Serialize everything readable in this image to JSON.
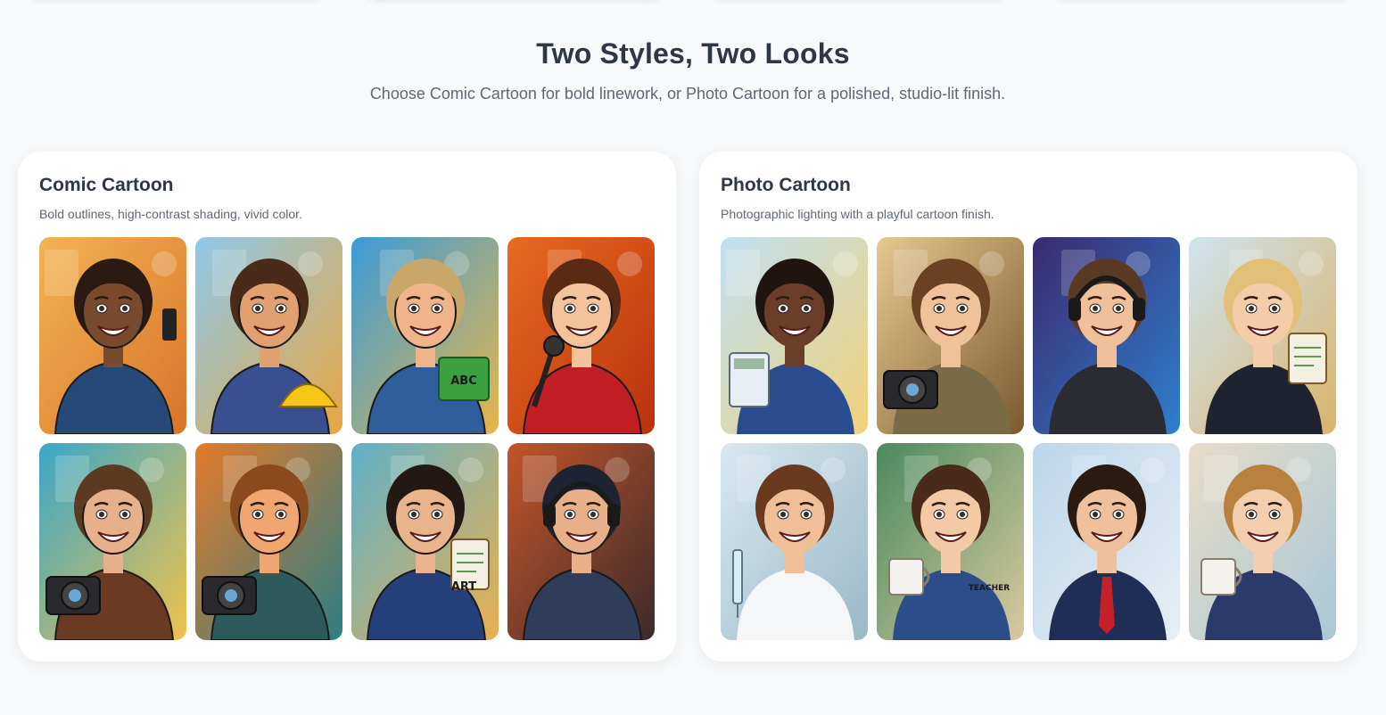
{
  "section": {
    "title": "Two Styles, Two Looks",
    "subtitle": "Choose Comic Cartoon for bold linework, or Photo Cartoon for a polished, studio-lit finish."
  },
  "panels": [
    {
      "title": "Comic Cartoon",
      "description": "Bold outlines, high-contrast shading, vivid color.",
      "images": [
        {
          "subject": "Businesswoman with phone",
          "bg": "#f2b451",
          "bg2": "#d9732a",
          "skin": "#7a4a2e",
          "hair": "#2a1a12",
          "outfit": "#254a7a",
          "prop": "phone"
        },
        {
          "subject": "Construction engineer with blueprints",
          "bg": "#8ec9ea",
          "bg2": "#e9a640",
          "skin": "#e0a070",
          "hair": "#4a2a18",
          "outfit": "#3a4f8f",
          "prop": "hardhat"
        },
        {
          "subject": "Teacher with ABC book",
          "bg": "#3a9bd8",
          "bg2": "#e8b64a",
          "skin": "#f0b48a",
          "hair": "#c9a76a",
          "outfit": "#2e5e9c",
          "prop": "book",
          "text": "ABC"
        },
        {
          "subject": "Singer with microphone",
          "bg": "#ea6a1f",
          "bg2": "#b8320e",
          "skin": "#f3c39c",
          "hair": "#5a2a14",
          "outfit": "#c21f25",
          "prop": "mic"
        },
        {
          "subject": "Traveler with camera",
          "bg": "#3aa6c9",
          "bg2": "#f1c24a",
          "skin": "#e6b08a",
          "hair": "#5c3a22",
          "outfit": "#6a3a24",
          "prop": "camera"
        },
        {
          "subject": "Photographer with camera",
          "bg": "#e47a2a",
          "bg2": "#2c7f86",
          "skin": "#f0a670",
          "hair": "#8a4a1e",
          "outfit": "#2f5a5c",
          "prop": "camera"
        },
        {
          "subject": "Art teacher with clipboard",
          "bg": "#5fb0c8",
          "bg2": "#e9b050",
          "skin": "#e9b48c",
          "hair": "#231814",
          "outfit": "#253f7a",
          "prop": "clipboard",
          "text": "ART"
        },
        {
          "subject": "Gamer with headset",
          "bg": "#c4552a",
          "bg2": "#3b2a2a",
          "skin": "#e7b088",
          "hair": "#1e2332",
          "outfit": "#2f3d5a",
          "prop": "headset"
        }
      ]
    },
    {
      "title": "Photo Cartoon",
      "description": "Photographic lighting with a playful cartoon finish.",
      "images": [
        {
          "subject": "Accountant with calculator",
          "bg": "#bfe0f2",
          "bg2": "#f2d27a",
          "skin": "#6a3e28",
          "hair": "#1f1410",
          "outfit": "#2a4d8f",
          "prop": "calculator"
        },
        {
          "subject": "Photographer with camera",
          "bg": "#e6c890",
          "bg2": "#7a5a30",
          "skin": "#f0c29a",
          "hair": "#6a4222",
          "outfit": "#7a6a48",
          "prop": "camera"
        },
        {
          "subject": "Streamer at gaming desk",
          "bg": "#3b2a6e",
          "bg2": "#2f7fcf",
          "skin": "#efc09a",
          "hair": "#5a3a22",
          "outfit": "#2b2b33",
          "prop": "headset"
        },
        {
          "subject": "Business owner in suit",
          "bg": "#cfe3ef",
          "bg2": "#d9b46a",
          "skin": "#f3cca8",
          "hair": "#e2c07a",
          "outfit": "#1f2330",
          "prop": "clipboard"
        },
        {
          "subject": "Doctor with syringe",
          "bg": "#d8e8f0",
          "bg2": "#9ab8c8",
          "skin": "#f0bf98",
          "hair": "#6a3a1e",
          "outfit": "#f4f6f8",
          "prop": "syringe"
        },
        {
          "subject": "Teacher with mug",
          "bg": "#4a8a5e",
          "bg2": "#d9c9a0",
          "skin": "#f3c9a6",
          "hair": "#4a2a18",
          "outfit": "#2d4d8a",
          "prop": "mug",
          "text": "TEACHER"
        },
        {
          "subject": "Businessman flexing",
          "bg": "#bcd6ea",
          "bg2": "#e7eef4",
          "skin": "#efc09c",
          "hair": "#2a1a12",
          "outfit": "#1f2e55",
          "prop": "tie"
        },
        {
          "subject": "CEO with coffee",
          "bg": "#e8dcc8",
          "bg2": "#a8c8d8",
          "skin": "#f3cfb0",
          "hair": "#b8823e",
          "outfit": "#2a3a6a",
          "prop": "mug"
        }
      ]
    }
  ],
  "peek_cards": [
    "",
    "",
    "",
    ""
  ]
}
